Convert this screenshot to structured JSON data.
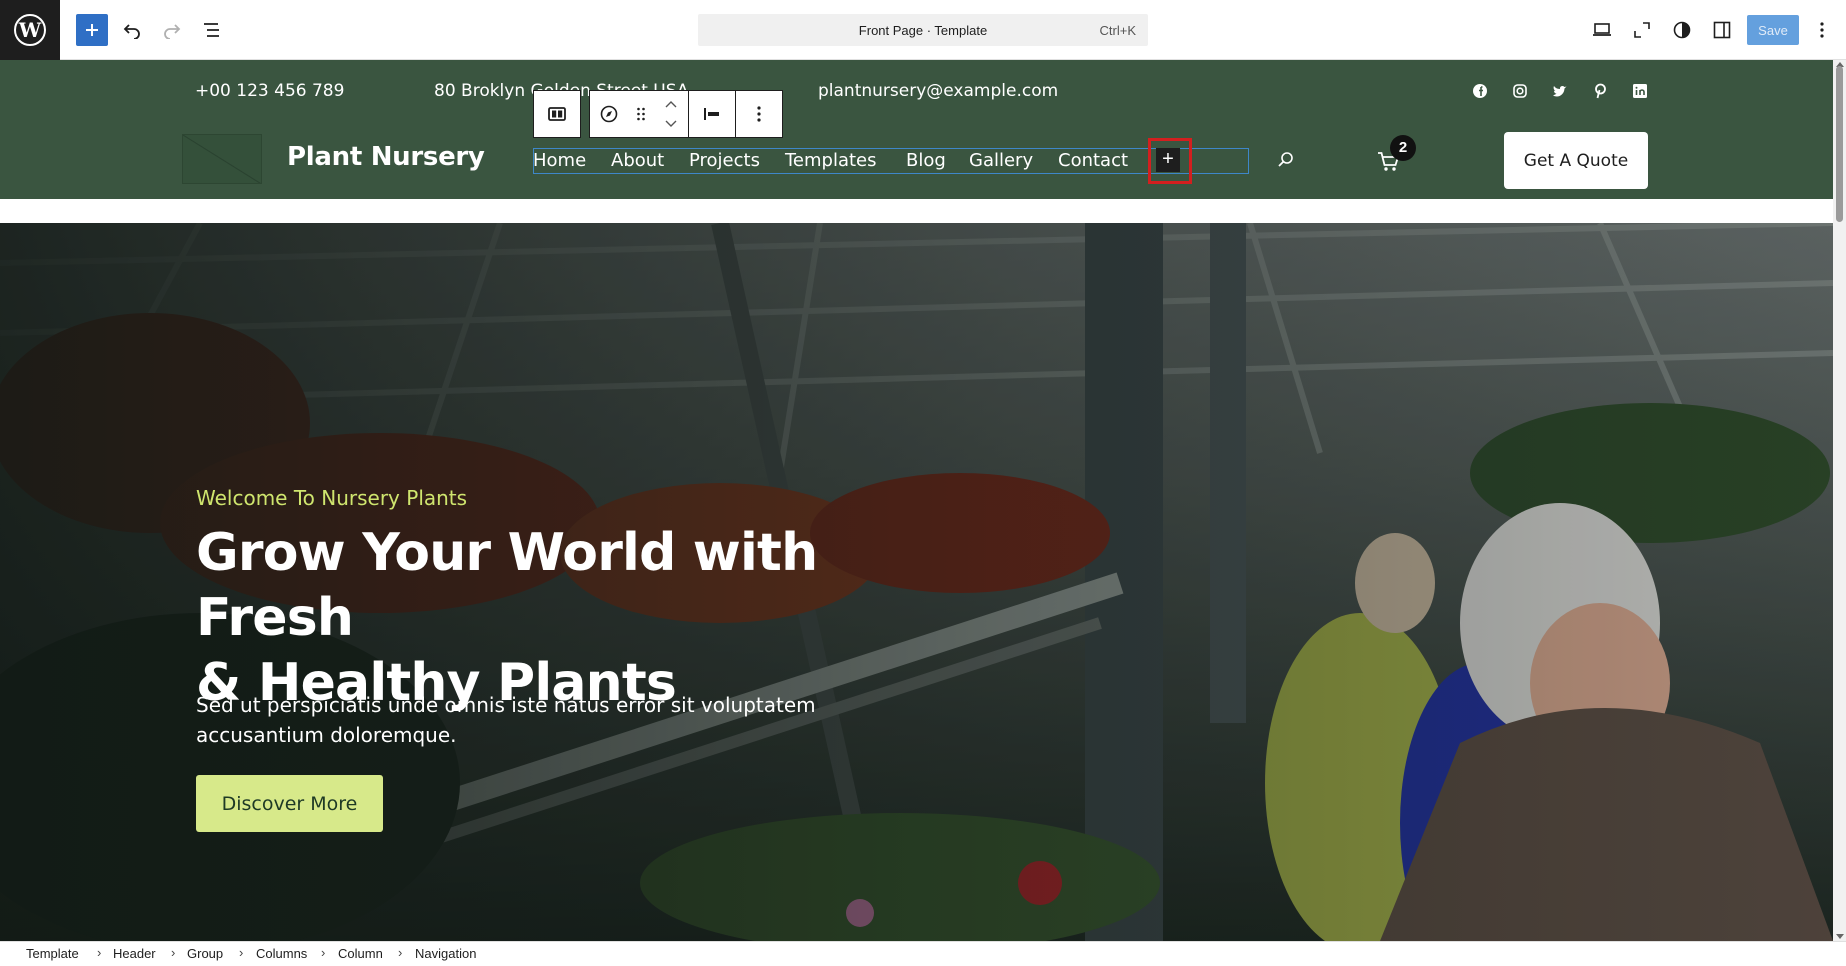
{
  "toolbar": {
    "doc_title": "Front Page · Template",
    "shortcut": "Ctrl+K",
    "save_label": "Save"
  },
  "header": {
    "phone": "+00 123 456 789",
    "address": "80 Broklyn Golden Street USA",
    "email": "plantnursery@example.com",
    "site_title": "Plant Nursery",
    "nav": [
      "Home",
      "About",
      "Projects",
      "Templates",
      "Blog",
      "Gallery",
      "Contact"
    ],
    "cart_count": "2",
    "quote_label": "Get A Quote",
    "social_icons": [
      "facebook-icon",
      "instagram-icon",
      "twitter-icon",
      "pinterest-icon",
      "linkedin-icon"
    ]
  },
  "hero": {
    "kicker": "Welcome To Nursery Plants",
    "title_line1": "Grow Your World with Fresh",
    "title_line2": "& Healthy Plants",
    "text": "Sed ut perspiciatis unde omnis iste natus error sit voluptatem accusantium doloremque.",
    "button": "Discover More"
  },
  "breadcrumb": [
    "Template",
    "Header",
    "Group",
    "Columns",
    "Column",
    "Navigation"
  ],
  "colors": {
    "header_bg": "#3a5540",
    "accent_green": "#cfe56e",
    "button_green": "#d7e98a",
    "selection_blue": "#3e87c9",
    "highlight_red": "#d31f1f"
  }
}
